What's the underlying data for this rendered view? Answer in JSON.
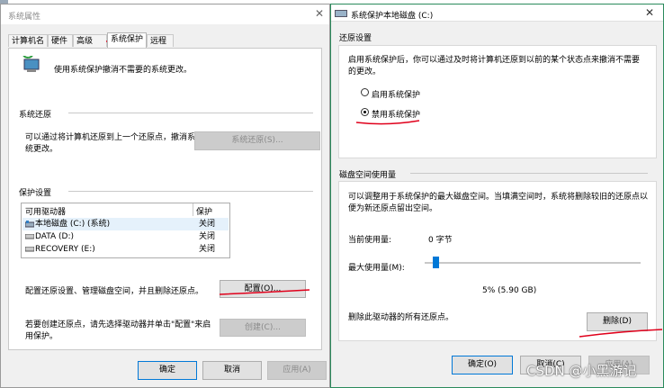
{
  "left_dialog": {
    "title": "系统属性",
    "close": "✕",
    "tabs": [
      "计算机名",
      "硬件",
      "高级",
      "系统保护",
      "远程"
    ],
    "intro": "使用系统保护撤消不需要的系统更改。",
    "restore_group": "系统还原",
    "restore_desc_1": "可以通过将计算机还原到上一个还原点，撤消系",
    "restore_desc_2": "统更改。",
    "restore_button": "系统还原(S)...",
    "protect_group": "保护设置",
    "table_headers": [
      "可用驱动器",
      "保护"
    ],
    "drives": [
      {
        "name": "本地磁盘 (C:) (系统)",
        "status": "关闭"
      },
      {
        "name": "DATA (D:)",
        "status": "关闭"
      },
      {
        "name": "RECOVERY (E:)",
        "status": "关闭"
      }
    ],
    "config_desc": "配置还原设置、管理磁盘空间，并且删除还原点。",
    "config_button": "配置(O)...",
    "create_desc_1": "若要创建还原点，请先选择驱动器并单击\"配置\"来启",
    "create_desc_2": "用保护。",
    "create_button": "创建(C)...",
    "ok": "确定",
    "cancel": "取消",
    "apply": "应用(A)"
  },
  "right_dialog": {
    "title": "系统保护本地磁盘 (C:)",
    "close": "✕",
    "restore_group": "还原设置",
    "restore_desc_1": "启用系统保护后，你可以通过及时将计算机还原到以前的某个状态点来撤消不需要",
    "restore_desc_2": "的更改。",
    "radio_enable": "启用系统保护",
    "radio_disable": "禁用系统保护",
    "selected_radio": "禁用系统保护",
    "disk_group": "磁盘空间使用量",
    "disk_desc_1": "可以调整用于系统保护的最大磁盘空间。当填满空间时，系统将删除较旧的还原点以",
    "disk_desc_2": "便为新还原点留出空间。",
    "current_usage_label": "当前使用量:",
    "current_usage_value": "0 字节",
    "max_usage_label": "最大使用量(M):",
    "max_usage_value": "5% (5.90 GB)",
    "max_usage_fraction": 0.05,
    "delete_desc": "删除此驱动器的所有还原点。",
    "delete_button": "删除(D)",
    "ok": "确定(O)",
    "cancel": "取消(C)",
    "apply": "应用(A)"
  },
  "watermark": "CSDN @小黑游记",
  "colors": {
    "accent": "#0078d7",
    "annotation_red": "#e0001b"
  }
}
